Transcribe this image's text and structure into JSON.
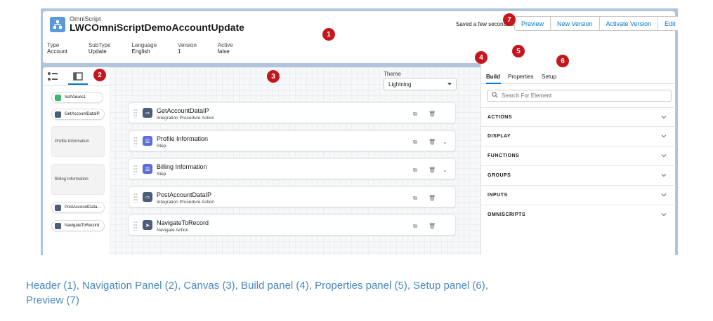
{
  "header": {
    "kind_label": "OmniScript",
    "title": "LWCOmniScriptDemoAccountUpdate",
    "saved_text": "Saved a few seconds ago",
    "buttons": {
      "preview": "Preview",
      "new_version": "New Version",
      "activate_version": "Activate Version",
      "edit": "Edit"
    },
    "meta": [
      {
        "key": "Type",
        "value": "Account"
      },
      {
        "key": "SubType",
        "value": "Update"
      },
      {
        "key": "Language",
        "value": "English"
      },
      {
        "key": "Version",
        "value": "1"
      },
      {
        "key": "Active",
        "value": "false"
      }
    ]
  },
  "nav": {
    "items": [
      {
        "label": "SetValues1",
        "icon_color": "#3bba6b"
      },
      {
        "label": "GetAccountDataIP",
        "icon_color": "#4a5d7a"
      },
      {
        "label": "Profile Information"
      },
      {
        "label": "Billing Information"
      },
      {
        "label": "PostAccountData...",
        "icon_color": "#4a5d7a"
      },
      {
        "label": "NavigateToRecord",
        "icon_color": "#4a5d7a"
      }
    ]
  },
  "canvas": {
    "theme_label": "Theme",
    "theme_value": "Lightning",
    "elements": [
      {
        "title": "GetAccountDataIP",
        "subtitle": "Integration Procedure Action",
        "icon": "integration-icon",
        "icon_color": "#4a5d7a"
      },
      {
        "title": "Profile Information",
        "subtitle": "Step",
        "icon": "step-icon",
        "icon_color": "#5a6fd6"
      },
      {
        "title": "Billing Information",
        "subtitle": "Step",
        "icon": "step-icon",
        "icon_color": "#5a6fd6"
      },
      {
        "title": "PostAccountDataIP",
        "subtitle": "Integration Procedure Action",
        "icon": "integration-icon",
        "icon_color": "#4a5d7a"
      },
      {
        "title": "NavigateToRecord",
        "subtitle": "Navigate Action",
        "icon": "navigate-icon",
        "icon_color": "#4a5d7a"
      }
    ]
  },
  "right_panel": {
    "tabs": [
      "Build",
      "Properties",
      "Setup"
    ],
    "search_placeholder": "Search For Element",
    "sections": [
      "ACTIONS",
      "DISPLAY",
      "FUNCTIONS",
      "GROUPS",
      "INPUTS",
      "OMNISCRIPTS"
    ]
  },
  "badges": [
    "1",
    "2",
    "3",
    "4",
    "5",
    "6",
    "7"
  ],
  "caption": {
    "parts": [
      {
        "link": "Header",
        "num": " (1), "
      },
      {
        "link": "Navigation Panel",
        "num": " (2), "
      },
      {
        "link": "Canvas",
        "num": " (3), "
      },
      {
        "link": "Build panel",
        "num": " (4), "
      },
      {
        "link": "Properties panel",
        "num": " (5), "
      },
      {
        "link": "Setup panel",
        "num": " (6), "
      },
      {
        "link": "Preview",
        "num": " (7)"
      }
    ]
  },
  "colors": {
    "badge": "#c4161c",
    "brand_blue": "#0176d3",
    "caption_blue": "#4a87c0"
  }
}
